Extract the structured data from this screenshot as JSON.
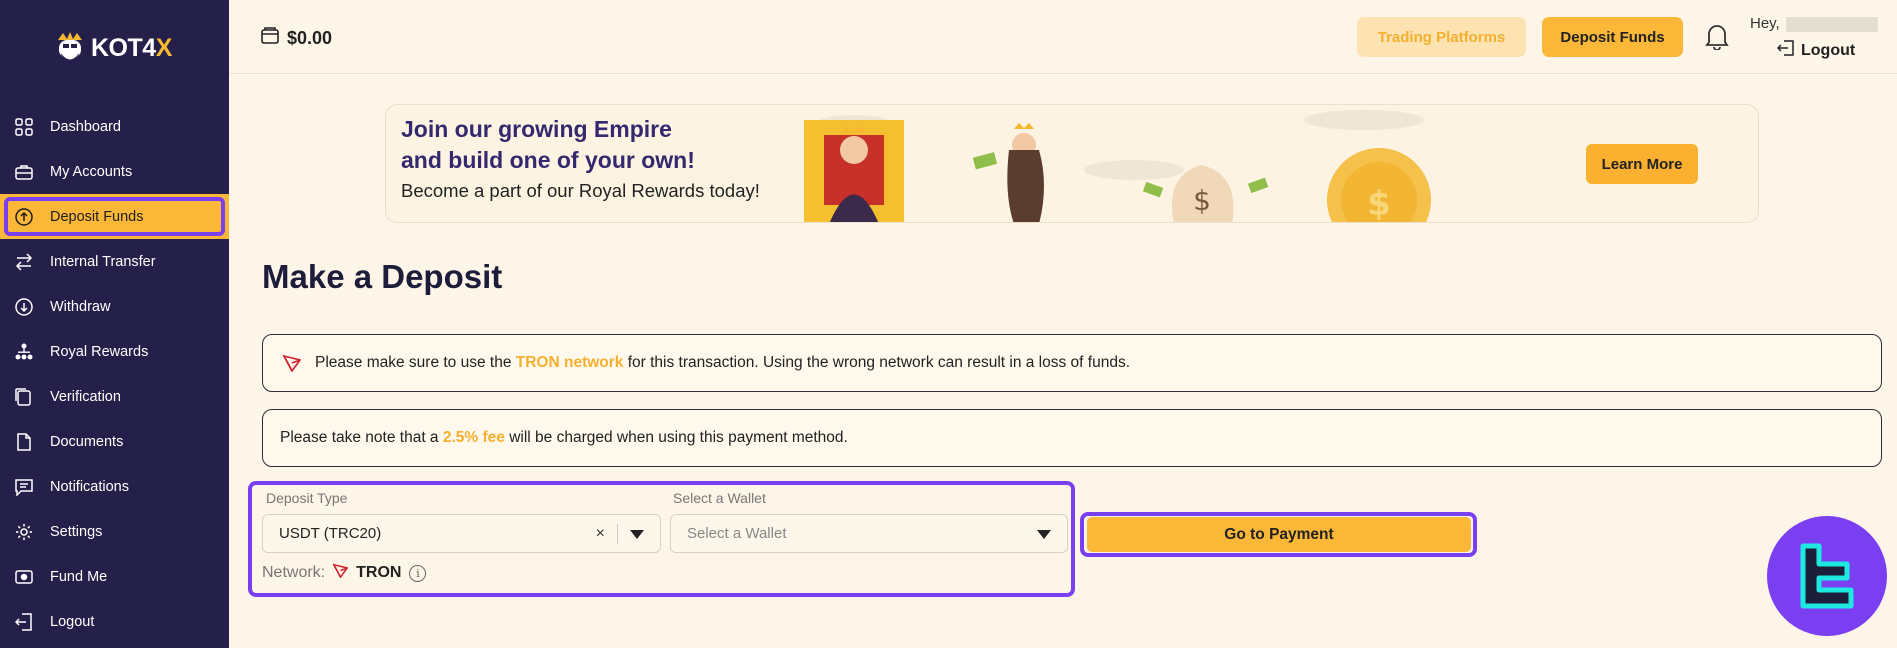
{
  "brand": {
    "logo_text_main": "KOT4",
    "logo_text_accent": "X"
  },
  "sidebar": {
    "items": [
      {
        "label": "Dashboard",
        "icon": "dashboard-icon"
      },
      {
        "label": "My Accounts",
        "icon": "briefcase-icon"
      },
      {
        "label": "Deposit Funds",
        "icon": "arrow-up-circle-icon",
        "active": true
      },
      {
        "label": "Internal Transfer",
        "icon": "transfer-icon"
      },
      {
        "label": "Withdraw",
        "icon": "arrow-down-circle-icon"
      },
      {
        "label": "Royal Rewards",
        "icon": "hierarchy-icon"
      },
      {
        "label": "Verification",
        "icon": "id-card-icon"
      },
      {
        "label": "Documents",
        "icon": "document-icon"
      },
      {
        "label": "Notifications",
        "icon": "message-icon"
      },
      {
        "label": "Settings",
        "icon": "gear-icon"
      },
      {
        "label": "Fund Me",
        "icon": "wallet-icon"
      },
      {
        "label": "Logout",
        "icon": "logout-icon"
      }
    ]
  },
  "header": {
    "balance": "$0.00",
    "trading_platforms": "Trading Platforms",
    "deposit_funds": "Deposit Funds",
    "greeting": "Hey,",
    "logout": "Logout"
  },
  "banner": {
    "headline_line1": "Join our growing Empire",
    "headline_line2": "and build one of your own!",
    "subtext": "Become a part of our Royal Rewards today!",
    "cta": "Learn More"
  },
  "main": {
    "title": "Make a Deposit",
    "notice1": {
      "pre": "Please make sure to use the ",
      "highlight": "TRON network",
      "post": " for this transaction. Using the wrong network can result in a loss of funds."
    },
    "notice2": {
      "pre": "Please take note that a ",
      "highlight": "2.5% fee",
      "post": " will be charged when using this payment method."
    },
    "form": {
      "deposit_type_label": "Deposit Type",
      "deposit_type_value": "USDT (TRC20)",
      "clear_symbol": "×",
      "wallet_label": "Select a Wallet",
      "wallet_placeholder": "Select a Wallet",
      "network_label": "Network:",
      "network_value": "TRON",
      "info_symbol": "i"
    },
    "submit": "Go to Payment"
  },
  "colors": {
    "sidebar_bg": "#24204a",
    "accent": "#fbb737",
    "highlight_outline": "#7b3ff2",
    "page_bg": "#fdf5e8"
  }
}
